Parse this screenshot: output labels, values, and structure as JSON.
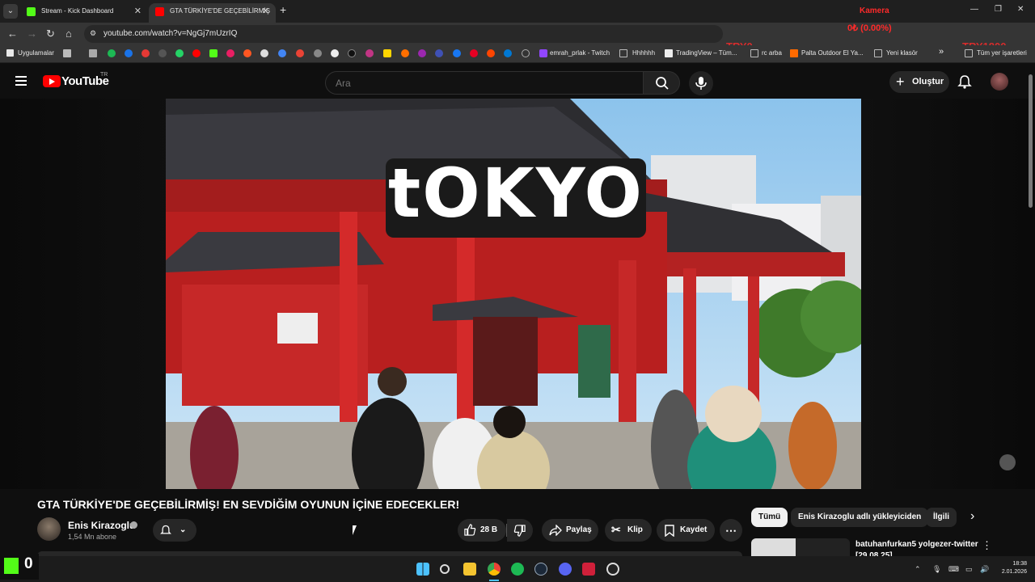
{
  "browser": {
    "tabs": [
      {
        "title": "Stream - Kick Dashboard",
        "favicon": "kick-icon",
        "color": "#53fc18"
      },
      {
        "title": "GTA TÜRKİYE'DE GEÇEBİLİRMİŞ",
        "favicon": "youtube-icon",
        "color": "#ff0000"
      }
    ],
    "url": "youtube.com/watch?v=NgGj7mUzrIQ"
  },
  "overlay": {
    "line1": "Kamera",
    "line2": "0₺ (0.00%)",
    "left_tag": "TRY0",
    "right_tag": "TRY1800"
  },
  "bookmarks": {
    "apps_label": "Uygulamalar",
    "items": [
      "emrah_prlak - Twitch",
      "Hhhhhh",
      "TradingView – Tüm...",
      "rc arba",
      "Palta Outdoor El Ya...",
      "Yeni klasör"
    ],
    "all_label": "Tüm yer işaretleri"
  },
  "youtube": {
    "logo_text": "YouTube",
    "country_code": "TR",
    "search_placeholder": "Ara",
    "create_label": "Oluştur"
  },
  "video": {
    "thumbnail_text": "tOKYO",
    "title": "GTA TÜRKİYE'DE GEÇEBİLİRMİŞ! EN SEVDİĞİM OYUNUN İÇİNE EDECEKLER!",
    "channel": "Enis Kirazoglu",
    "subscribers": "1,54 Mn abone",
    "likes": "28 B",
    "share_label": "Paylaş",
    "clip_label": "Klip",
    "save_label": "Kaydet"
  },
  "sidebar": {
    "chips": [
      "Tümü",
      "Enis Kirazoglu adlı yükleyiciden",
      "İlgili"
    ],
    "first_video_title": "batuhanfurkan5 yolgezer-twitter",
    "first_video_date": "[29.08.25]"
  },
  "kick_widget": {
    "count": "0"
  },
  "taskbar": {
    "time": "18:38",
    "date": "2.01.2026"
  }
}
